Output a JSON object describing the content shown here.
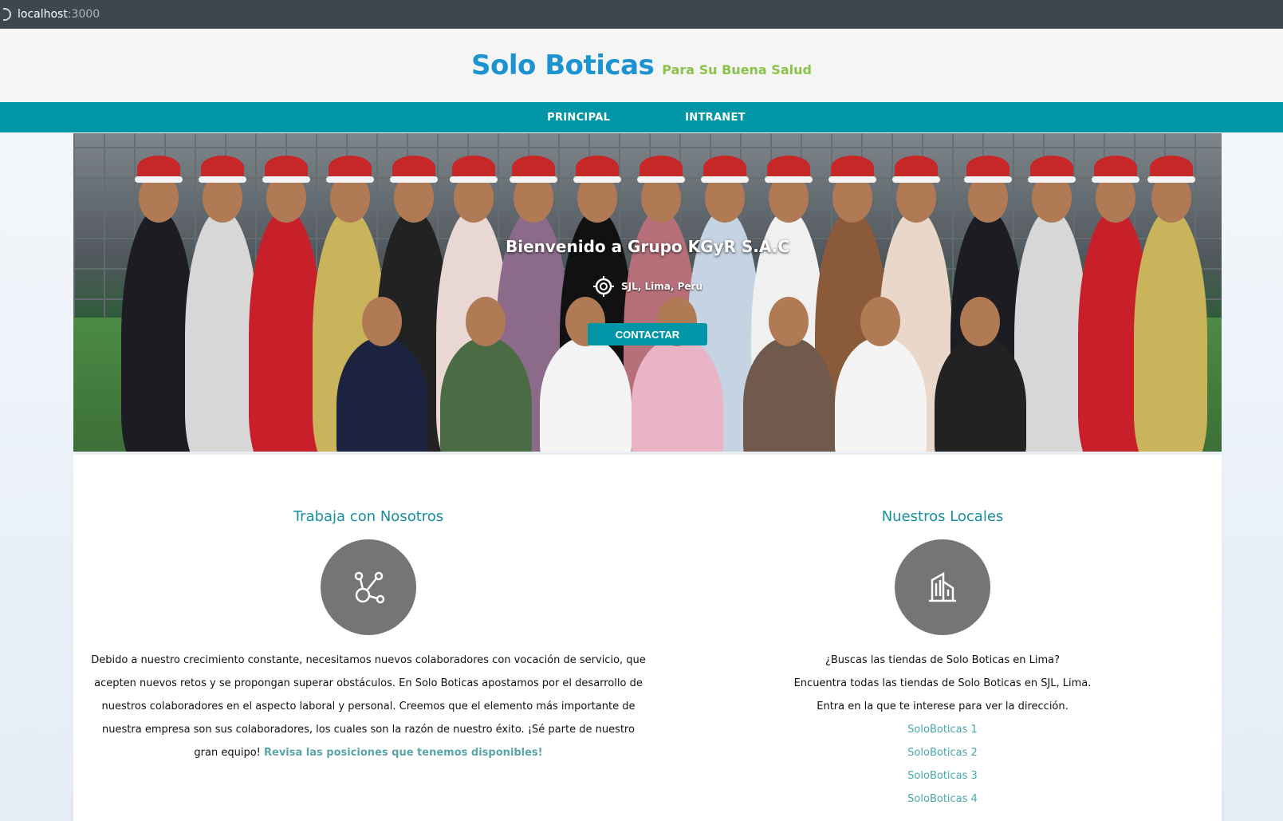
{
  "browser": {
    "url_host": "localhost",
    "url_port": ":3000"
  },
  "header": {
    "title": "Solo Boticas",
    "tagline": "Para Su Buena Salud"
  },
  "nav": {
    "items": [
      {
        "label": "PRINCIPAL"
      },
      {
        "label": "INTRANET"
      }
    ]
  },
  "hero": {
    "title": "Bienvenido a Grupo KGyR S.A.C",
    "location": "SJL, Lima, Peru",
    "button": "CONTACTAR"
  },
  "sections": {
    "work": {
      "title": "Trabaja con Nosotros",
      "icon": "share-nodes-icon",
      "text": "Debido a nuestro crecimiento constante, necesitamos nuevos colaboradores con vocación de servicio, que acepten nuevos retos y se propongan superar obstáculos. En Solo Boticas apostamos por el desarrollo de nuestros colaboradores en el aspecto laboral y personal. Creemos que el elemento más importante de nuestra empresa son sus colaboradores, los cuales son la razón de nuestro éxito. ¡Sé parte de nuestro gran equipo!",
      "link": "Revisa las posiciones que tenemos disponibles!"
    },
    "stores": {
      "title": "Nuestros Locales",
      "icon": "building-icon",
      "line1": "¿Buscas las tiendas de Solo Boticas en Lima?",
      "line2": "Encuentra todas las tiendas de Solo Boticas en SJL, Lima.",
      "line3": "Entra en la que te interese para ver la dirección.",
      "items": [
        "SoloBoticas 1",
        "SoloBoticas 2",
        "SoloBoticas 3",
        "SoloBoticas 4"
      ]
    }
  },
  "colors": {
    "brand_blue": "#1b94d1",
    "tagline_green": "#8bc34a",
    "teal": "#0095a7",
    "icon_circle": "#757575"
  }
}
